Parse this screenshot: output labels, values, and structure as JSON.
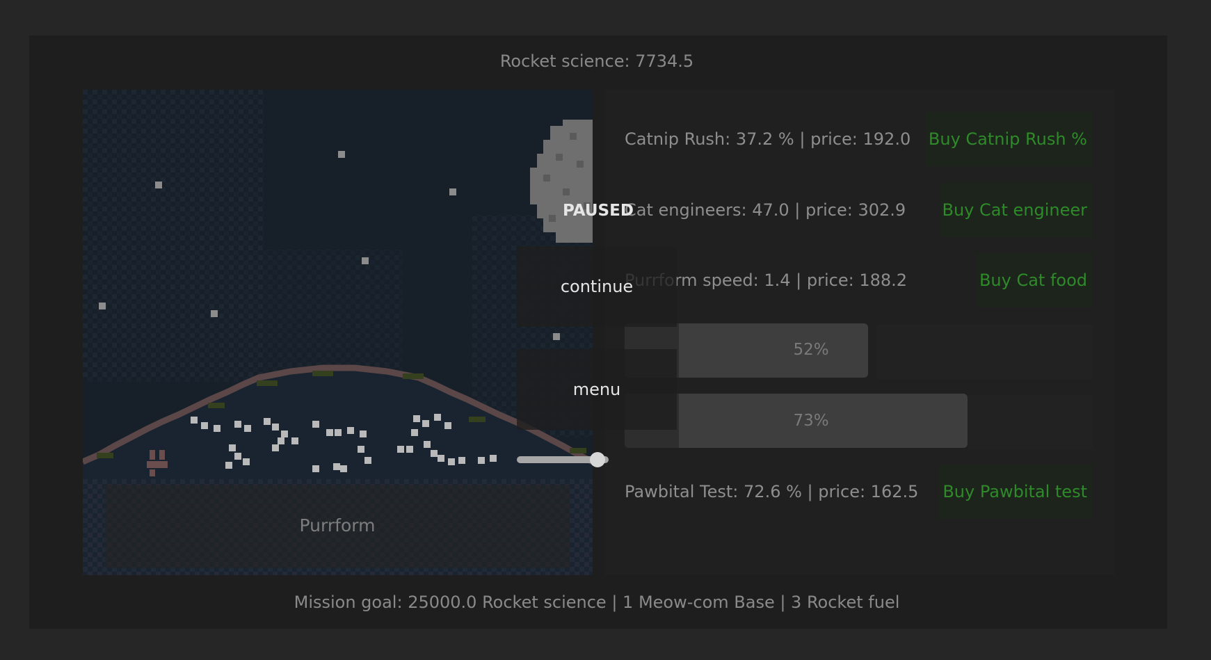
{
  "header": {
    "rocket_science": "Rocket science: 7734.5"
  },
  "scene": {
    "purrform_label": "Purrform"
  },
  "upgrades": [
    {
      "text": "Catnip Rush: 37.2 % | price: 192.0",
      "button": "Buy Catnip Rush %"
    },
    {
      "text": "Cat engineers: 47.0 | price: 302.9",
      "button": "Buy Cat engineer"
    },
    {
      "text": "Purrform speed: 1.4 | price: 188.2",
      "button": "Buy Cat food"
    }
  ],
  "progress_bars": [
    {
      "label": "52%",
      "value": 0.52
    },
    {
      "label": "73%",
      "value": 0.73
    }
  ],
  "pawbital": {
    "text": "Pawbital Test: 72.6 % | price: 162.5",
    "button": "Buy Pawbital test"
  },
  "footer": {
    "mission": "Mission goal: 25000.0 Rocket science | 1 Meow-com Base | 3 Rocket fuel"
  },
  "pause_menu": {
    "title": "PAUSED",
    "continue_label": "continue",
    "menu_label": "menu",
    "volume": 0.88
  },
  "colors": {
    "buy_text": "#2f8a2a",
    "sky": "#172029",
    "planet_edge": "#5b4747"
  }
}
